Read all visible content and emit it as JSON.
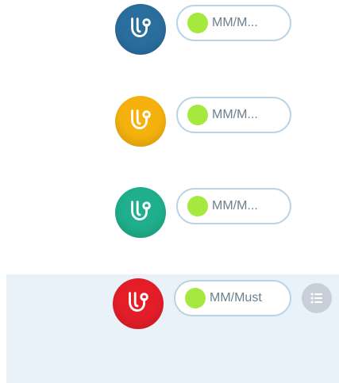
{
  "colors": {
    "status_green": "#a5e83e",
    "pill_border": "#b9d4e6",
    "selected_row_bg": "#e8f2f8"
  },
  "rows": [
    {
      "label": "MM/M...",
      "avatar_icon": "stethoscope-icon",
      "avatar_color": "#2a6e9e",
      "selected": false
    },
    {
      "label": "MM/M...",
      "avatar_icon": "stethoscope-icon",
      "avatar_color": "#f5b20e",
      "selected": false
    },
    {
      "label": "MM/M...",
      "avatar_icon": "stethoscope-icon",
      "avatar_color": "#1faf8c",
      "selected": false
    },
    {
      "label": "MM/Must",
      "avatar_icon": "stethoscope-icon",
      "avatar_color": "#e31e29",
      "selected": true,
      "action_icon": "list-icon"
    }
  ]
}
